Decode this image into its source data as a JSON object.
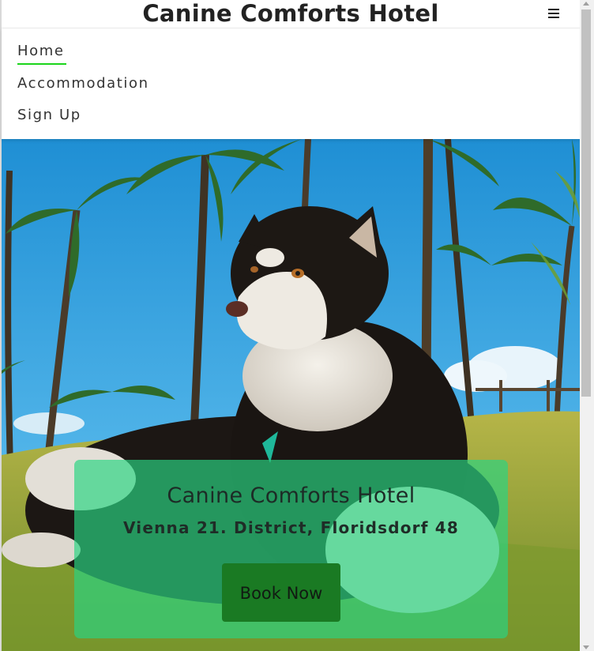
{
  "header": {
    "title": "Canine Comforts Hotel",
    "menu_icon": "hamburger-icon"
  },
  "nav": {
    "items": [
      {
        "label": "Home",
        "active": true
      },
      {
        "label": "Accommodation",
        "active": false
      },
      {
        "label": "Sign Up",
        "active": false
      }
    ],
    "active_underline_color": "#1bd51b"
  },
  "hero": {
    "image": "husky-dog-lying-on-grass-under-palm-trees",
    "card": {
      "title": "Canine Comforts Hotel",
      "address": "Vienna 21. District, Floridsdorf 48",
      "button_label": "Book Now",
      "background_color": "#2ad482",
      "button_color": "#1a7a23"
    }
  }
}
